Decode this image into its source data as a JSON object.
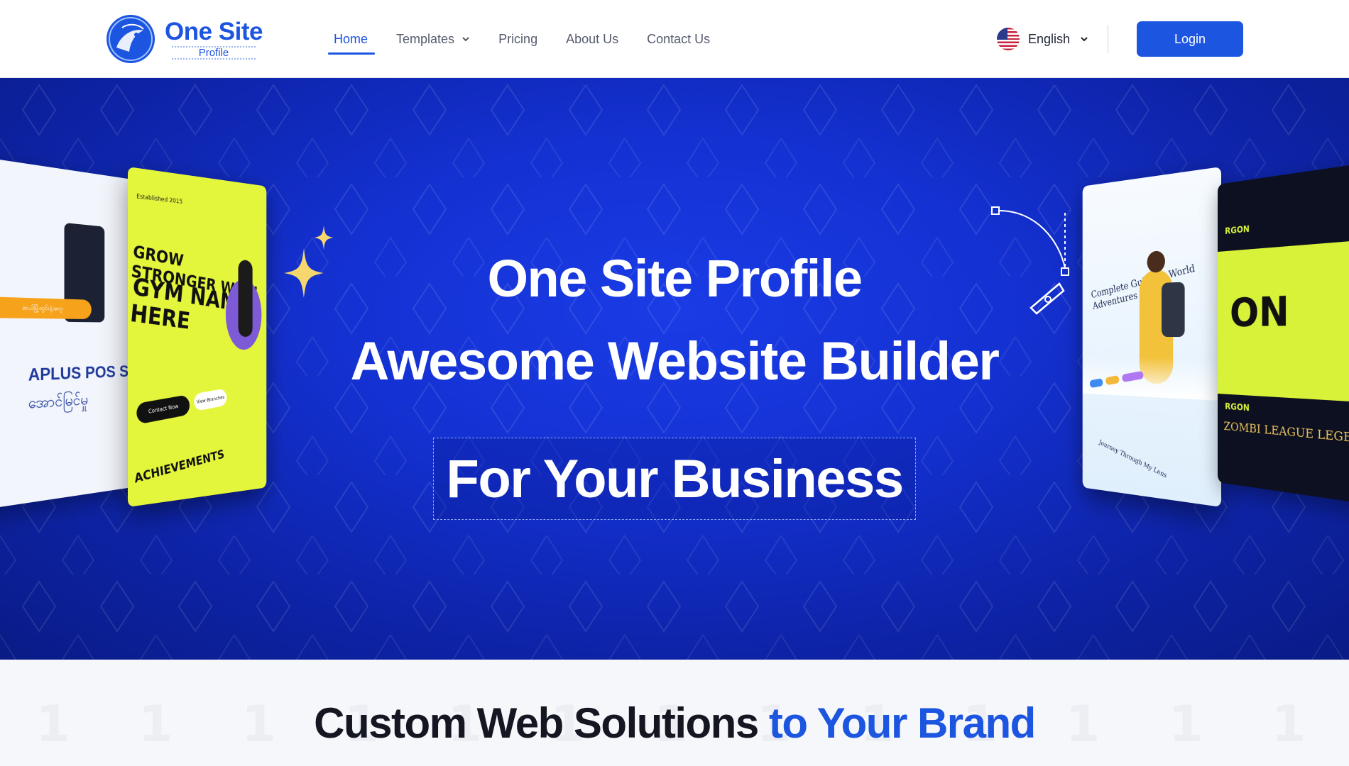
{
  "brand": {
    "name": "One Site",
    "sub": "Profile"
  },
  "nav": {
    "items": [
      {
        "label": "Home",
        "active": true
      },
      {
        "label": "Templates",
        "has_dropdown": true
      },
      {
        "label": "Pricing"
      },
      {
        "label": "About Us"
      },
      {
        "label": "Contact Us"
      }
    ]
  },
  "language": {
    "label": "English",
    "flag_icon": "us-flag-icon"
  },
  "login_label": "Login",
  "hero": {
    "line1": "One Site Profile",
    "line2": "Awesome Website Builder",
    "line3": "For Your Business"
  },
  "mockups": {
    "gym": {
      "established": "Established 2015",
      "headline1": "GROW STRONGER WITH",
      "headline2": "GYM NAME HERE",
      "contact_btn": "Contact Now",
      "view_btn": "View Branches",
      "section": "ACHIEVEMENTS"
    },
    "pos": {
      "tag": "ဆယ်မြို့တွင်းနဲ့အတူ",
      "brand": "APLUS POS S",
      "brand_line2": "အောင်မြင်မှု"
    },
    "travel": {
      "title": "Complete Guide to World Adventures",
      "footer": "Journey Through My Lens"
    },
    "gaming": {
      "label_top": "RGON",
      "big": "ON",
      "label_mid": "RGON",
      "logos": "ZOMBI LEAGUE LEGENDS"
    }
  },
  "section2": {
    "title_part1": "Custom Web Solutions ",
    "title_part2": "to Your Brand",
    "bg_digits": "1 1 1 1 1 1 1 1 1 1 1 1 1 1 1 1 1 1 1 1"
  },
  "colors": {
    "accent": "#1c55e0",
    "hero_bg": "#1431d2",
    "sparkle": "#f5d76e",
    "gym_lime": "#e4f63b"
  }
}
